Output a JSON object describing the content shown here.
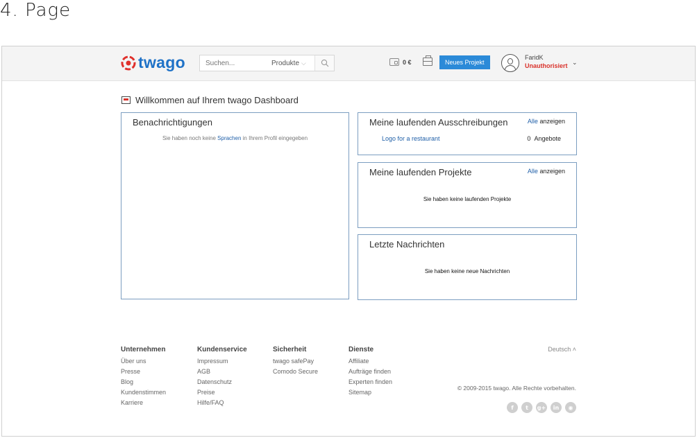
{
  "page_heading": "4. Page",
  "header": {
    "logo_text": "twago",
    "search": {
      "placeholder": "Suchen...",
      "dropdown_value": "Produkte",
      "chevron_glyph": "⌵"
    },
    "wallet_amount": "0 €",
    "new_project_label": "Neues Projekt",
    "user": {
      "name": "FaridK",
      "status": "Unauthorisiert",
      "chevron_glyph": "⌄"
    },
    "icons": {
      "logo": "twago-logo-icon",
      "search": "search-icon",
      "wallet": "wallet-icon",
      "briefcase": "briefcase-icon",
      "avatar": "user-avatar-icon"
    }
  },
  "welcome": "Willkommen auf Ihrem twago Dashboard",
  "panels": {
    "notifications": {
      "title": "Benachrichtigungen",
      "msg_prefix": "Sie haben noch keine",
      "msg_link": "Sprachen",
      "msg_suffix": "in Ihrem Profil eingegeben"
    },
    "tenders": {
      "title": "Meine laufenden Ausschreibungen",
      "view_all_link": "Alle",
      "view_all_text": "anzeigen",
      "items": [
        {
          "name": "Logo for a restaurant",
          "count": "0",
          "count_label": "Angebote"
        }
      ]
    },
    "projects": {
      "title": "Meine laufenden Projekte",
      "view_all_link": "Alle",
      "view_all_text": "anzeigen",
      "empty": "Sie haben keine laufenden Projekte"
    },
    "messages": {
      "title": "Letzte Nachrichten",
      "empty": "Sie haben keine neue Nachrichten"
    }
  },
  "footer": {
    "columns": [
      {
        "heading": "Unternehmen",
        "links": [
          "Über uns",
          "Presse",
          "Blog",
          "Kundenstimmen",
          "Karriere"
        ]
      },
      {
        "heading": "Kundenservice",
        "links": [
          "Impressum",
          "AGB",
          "Datenschutz",
          "Preise",
          "Hilfe/FAQ"
        ]
      },
      {
        "heading": "Sicherheit",
        "links": [
          "twago safePay",
          "Comodo Secure"
        ]
      },
      {
        "heading": "Dienste",
        "links": [
          "Affiliate",
          "Aufträge finden",
          "Experten finden",
          "Sitemap"
        ]
      }
    ],
    "language": "Deutsch ˄",
    "copyright": "© 2009-2015 twago. Alle Rechte vorbehalten.",
    "social": [
      {
        "name": "facebook-icon",
        "glyph": "f"
      },
      {
        "name": "twitter-icon",
        "glyph": "t"
      },
      {
        "name": "google-plus-icon",
        "glyph": "g+"
      },
      {
        "name": "linkedin-icon",
        "glyph": "in"
      },
      {
        "name": "rss-icon",
        "glyph": "◉"
      }
    ]
  },
  "colors": {
    "brand_blue": "#1f72c7",
    "button_blue": "#2b8ad8",
    "alert_red": "#d9322b",
    "panel_border": "#7b9dc0"
  }
}
